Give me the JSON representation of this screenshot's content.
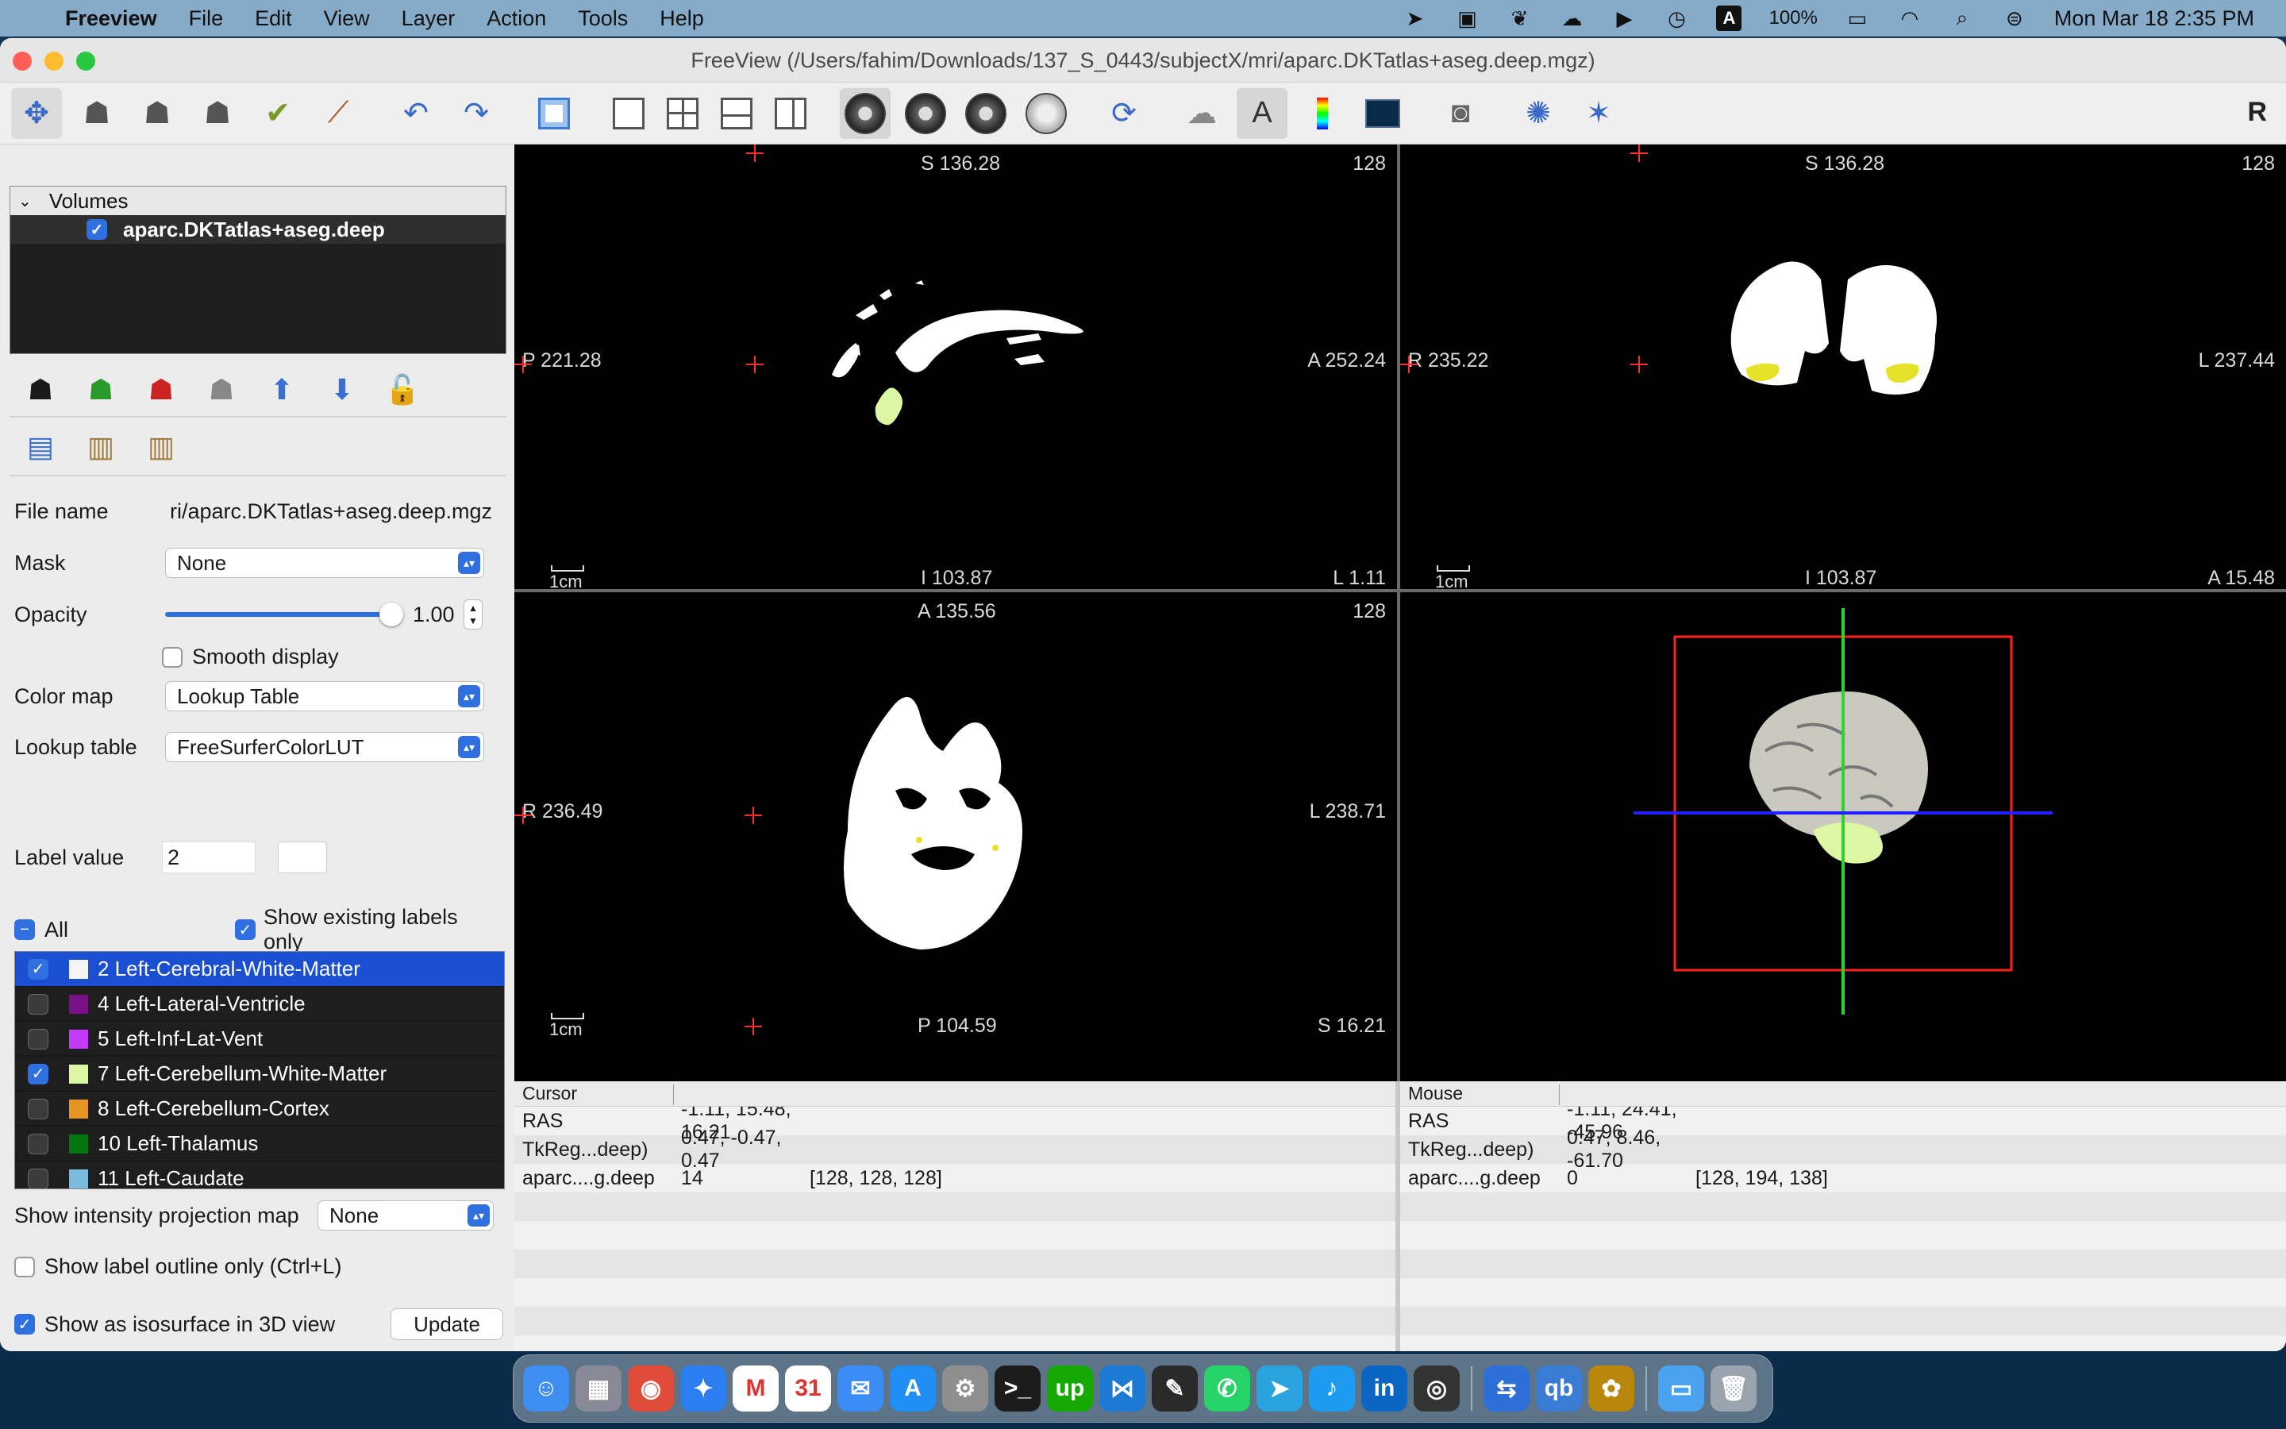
{
  "menubar": {
    "app_name": "Freeview",
    "items": [
      "File",
      "Edit",
      "View",
      "Layer",
      "Action",
      "Tools",
      "Help"
    ],
    "battery": "100%",
    "datetime": "Mon Mar 18  2:35 PM",
    "status_icons": [
      "navigation-icon",
      "stage-manager-icon",
      "bird-icon",
      "creative-cloud-icon",
      "play-icon",
      "time-machine-icon",
      "input-source-A-icon",
      "battery-icon",
      "wifi-icon",
      "spotlight-icon",
      "control-center-icon"
    ],
    "input_source": "A"
  },
  "window": {
    "title": "FreeView (/Users/fahim/Downloads/137_S_0443/subjectX/mri/aparc.DKTatlas+aseg.deep.mgz)",
    "right_label": "R"
  },
  "toolbar": {
    "icons": [
      "navigate-icon",
      "voxel-edit-icon",
      "recon-edit-icon",
      "roi-edit-icon",
      "point-set-edit-icon",
      "contour-icon",
      "undo-icon",
      "redo-icon",
      "toggle-panel-icon",
      "layout-1x1-icon",
      "layout-2x2-icon",
      "layout-1-3-icon",
      "layout-1-3-horizontal-icon",
      "sagittal-view-icon",
      "coronal-view-icon",
      "axial-view-icon",
      "3d-view-icon",
      "reset-view-icon",
      "show-surface-icon",
      "show-annotation-text-icon",
      "color-bar-icon",
      "show-command-console-icon",
      "snapshot-icon",
      "transform-volume-icon",
      "reposition-surface-icon"
    ]
  },
  "layers": {
    "header": "Volumes",
    "items": [
      {
        "name": "aparc.DKTatlas+aseg.deep",
        "checked": true
      }
    ],
    "action_icons": [
      "load-volume-icon",
      "new-volume-icon",
      "close-volume-icon",
      "save-volume-icon",
      "move-up-icon",
      "move-down-icon",
      "lock-icon"
    ],
    "edit_icons": [
      "copy-setting-icon",
      "paste-setting-icon",
      "paste-all-icon"
    ]
  },
  "properties": {
    "file_name_label": "File name",
    "file_name_value": "ri/aparc.DKTatlas+aseg.deep.mgz",
    "mask_label": "Mask",
    "mask_value": "None",
    "opacity_label": "Opacity",
    "opacity_value": "1.00",
    "opacity": 1.0,
    "smooth_label": "Smooth display",
    "smooth_checked": false,
    "colormap_label": "Color map",
    "colormap_value": "Lookup Table",
    "lut_label": "Lookup table",
    "lut_value": "FreeSurferColorLUT",
    "label_value_label": "Label value",
    "label_value": "2",
    "all_label": "All",
    "show_existing_label": "Show existing labels only",
    "labels": [
      {
        "text": "2 Left-Cerebral-White-Matter",
        "color": "#f5f5f5",
        "checked": true,
        "selected": true
      },
      {
        "text": "4 Left-Lateral-Ventricle",
        "color": "#781286",
        "checked": false,
        "selected": false
      },
      {
        "text": "5 Left-Inf-Lat-Vent",
        "color": "#c43afa",
        "checked": false,
        "selected": false
      },
      {
        "text": "7 Left-Cerebellum-White-Matter",
        "color": "#dcf8a4",
        "checked": true,
        "selected": false
      },
      {
        "text": "8 Left-Cerebellum-Cortex",
        "color": "#e69422",
        "checked": false,
        "selected": false
      },
      {
        "text": "10 Left-Thalamus",
        "color": "#00760e",
        "checked": false,
        "selected": false
      },
      {
        "text": "11 Left-Caudate",
        "color": "#7abadc",
        "checked": false,
        "selected": false
      }
    ],
    "projection_label": "Show intensity projection map",
    "projection_value": "None",
    "outline_label": "Show label outline only (Ctrl+L)",
    "isosurface_label": "Show as isosurface in 3D view",
    "update_button": "Update"
  },
  "views": {
    "sagittal": {
      "top": "S 136.28",
      "slice": "128",
      "left": "P 221.28",
      "right": "A 252.24",
      "bottom": "I 103.87",
      "bottom_right": "L 1.11",
      "scale": "1cm"
    },
    "coronal": {
      "top": "S 136.28",
      "slice": "128",
      "left": "R 235.22",
      "right": "L 237.44",
      "bottom": "I 103.87",
      "bottom_right": "A 15.48",
      "scale": "1cm"
    },
    "axial": {
      "top": "A 135.56",
      "slice": "128",
      "left": "R 236.49",
      "right": "L 238.71",
      "bottom": "P 104.59",
      "bottom_right": "S 16.21",
      "scale": "1cm"
    }
  },
  "info": {
    "cursor": {
      "header": "Cursor",
      "rows": [
        {
          "k": "RAS",
          "v1": "-1.11, 15.48, 16.21",
          "v2": ""
        },
        {
          "k": "TkReg...deep)",
          "v1": "0.47, -0.47, 0.47",
          "v2": ""
        },
        {
          "k": "aparc....g.deep",
          "v1": "14",
          "v2": "[128, 128, 128]"
        }
      ]
    },
    "mouse": {
      "header": "Mouse",
      "rows": [
        {
          "k": "RAS",
          "v1": "-1.11, 24.41, -45.96",
          "v2": ""
        },
        {
          "k": "TkReg...deep)",
          "v1": "0.47, 8.46, -61.70",
          "v2": ""
        },
        {
          "k": "aparc....g.deep",
          "v1": "0",
          "v2": "[128, 194, 138]"
        }
      ]
    }
  },
  "dock": {
    "apps": [
      {
        "name": "finder",
        "color": "#3d8ef0",
        "glyph": "☺"
      },
      {
        "name": "launchpad",
        "color": "#8a8a96",
        "glyph": "▦"
      },
      {
        "name": "chrome",
        "color": "#e04b3a",
        "glyph": "◉"
      },
      {
        "name": "safari",
        "color": "#2a7ef0",
        "glyph": "✦"
      },
      {
        "name": "gmail",
        "color": "#ffffff",
        "glyph": "M"
      },
      {
        "name": "calendar",
        "color": "#ffffff",
        "glyph": "31"
      },
      {
        "name": "mail",
        "color": "#3b8df5",
        "glyph": "✉"
      },
      {
        "name": "app-store",
        "color": "#1f8ff5",
        "glyph": "A"
      },
      {
        "name": "system-settings",
        "color": "#8f8f8f",
        "glyph": "⚙"
      },
      {
        "name": "terminal",
        "color": "#1c1c1c",
        "glyph": ">_"
      },
      {
        "name": "upwork",
        "color": "#14a800",
        "glyph": "up"
      },
      {
        "name": "vscode",
        "color": "#1c7ad4",
        "glyph": "⋈"
      },
      {
        "name": "script-editor",
        "color": "#2a2a2a",
        "glyph": "✎"
      },
      {
        "name": "whatsapp",
        "color": "#25d366",
        "glyph": "✆"
      },
      {
        "name": "telegram",
        "color": "#2aa3e0",
        "glyph": "➤"
      },
      {
        "name": "twitter",
        "color": "#1d9bf0",
        "glyph": "♪"
      },
      {
        "name": "linkedin",
        "color": "#0a66c2",
        "glyph": "in"
      },
      {
        "name": "github",
        "color": "#333333",
        "glyph": "◎"
      }
    ],
    "apps2": [
      {
        "name": "migration",
        "color": "#2d6fd6",
        "glyph": "⇆"
      },
      {
        "name": "qbittorrent",
        "color": "#3a7bd5",
        "glyph": "qb"
      },
      {
        "name": "freeview",
        "color": "#b8860b",
        "glyph": "✿"
      }
    ],
    "apps3": [
      {
        "name": "downloads-folder",
        "color": "#4aa3f0",
        "glyph": "▭"
      },
      {
        "name": "trash",
        "color": "#9aa4ad",
        "glyph": "🗑"
      }
    ]
  }
}
